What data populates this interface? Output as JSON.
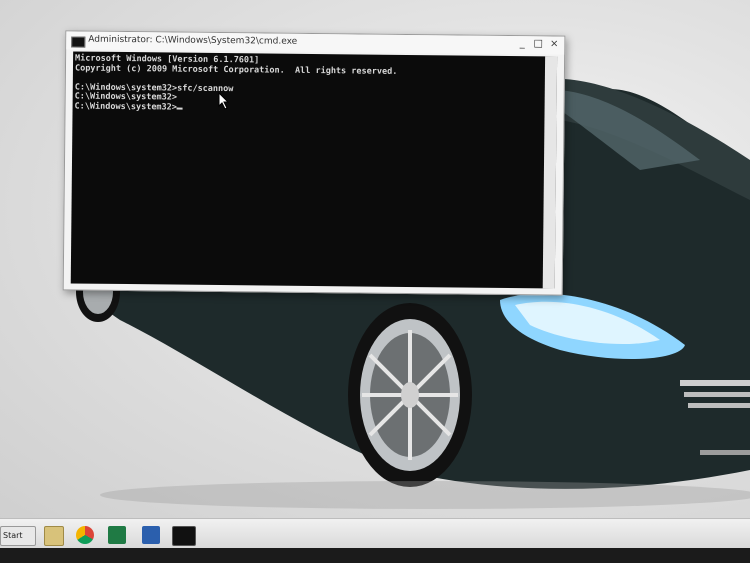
{
  "window": {
    "title": "Administrator: C:\\Windows\\System32\\cmd.exe",
    "controls": [
      "_",
      "□",
      "×"
    ]
  },
  "console": {
    "lines": [
      "Microsoft Windows [Version 6.1.7601]",
      "Copyright (c) 2009 Microsoft Corporation.  All rights reserved.",
      "",
      "C:\\Windows\\system32>sfc/scannow",
      "C:\\Windows\\system32>",
      "C:\\Windows\\system32>"
    ]
  },
  "taskbar": {
    "start_label": "Start",
    "icons": [
      "explorer-icon",
      "chrome-icon",
      "excel-icon",
      "word-icon",
      "cmd-icon"
    ]
  },
  "colors": {
    "console_bg": "#0b0b0b",
    "console_fg": "#d8d8d8",
    "car_body": "#1f2b2c"
  }
}
